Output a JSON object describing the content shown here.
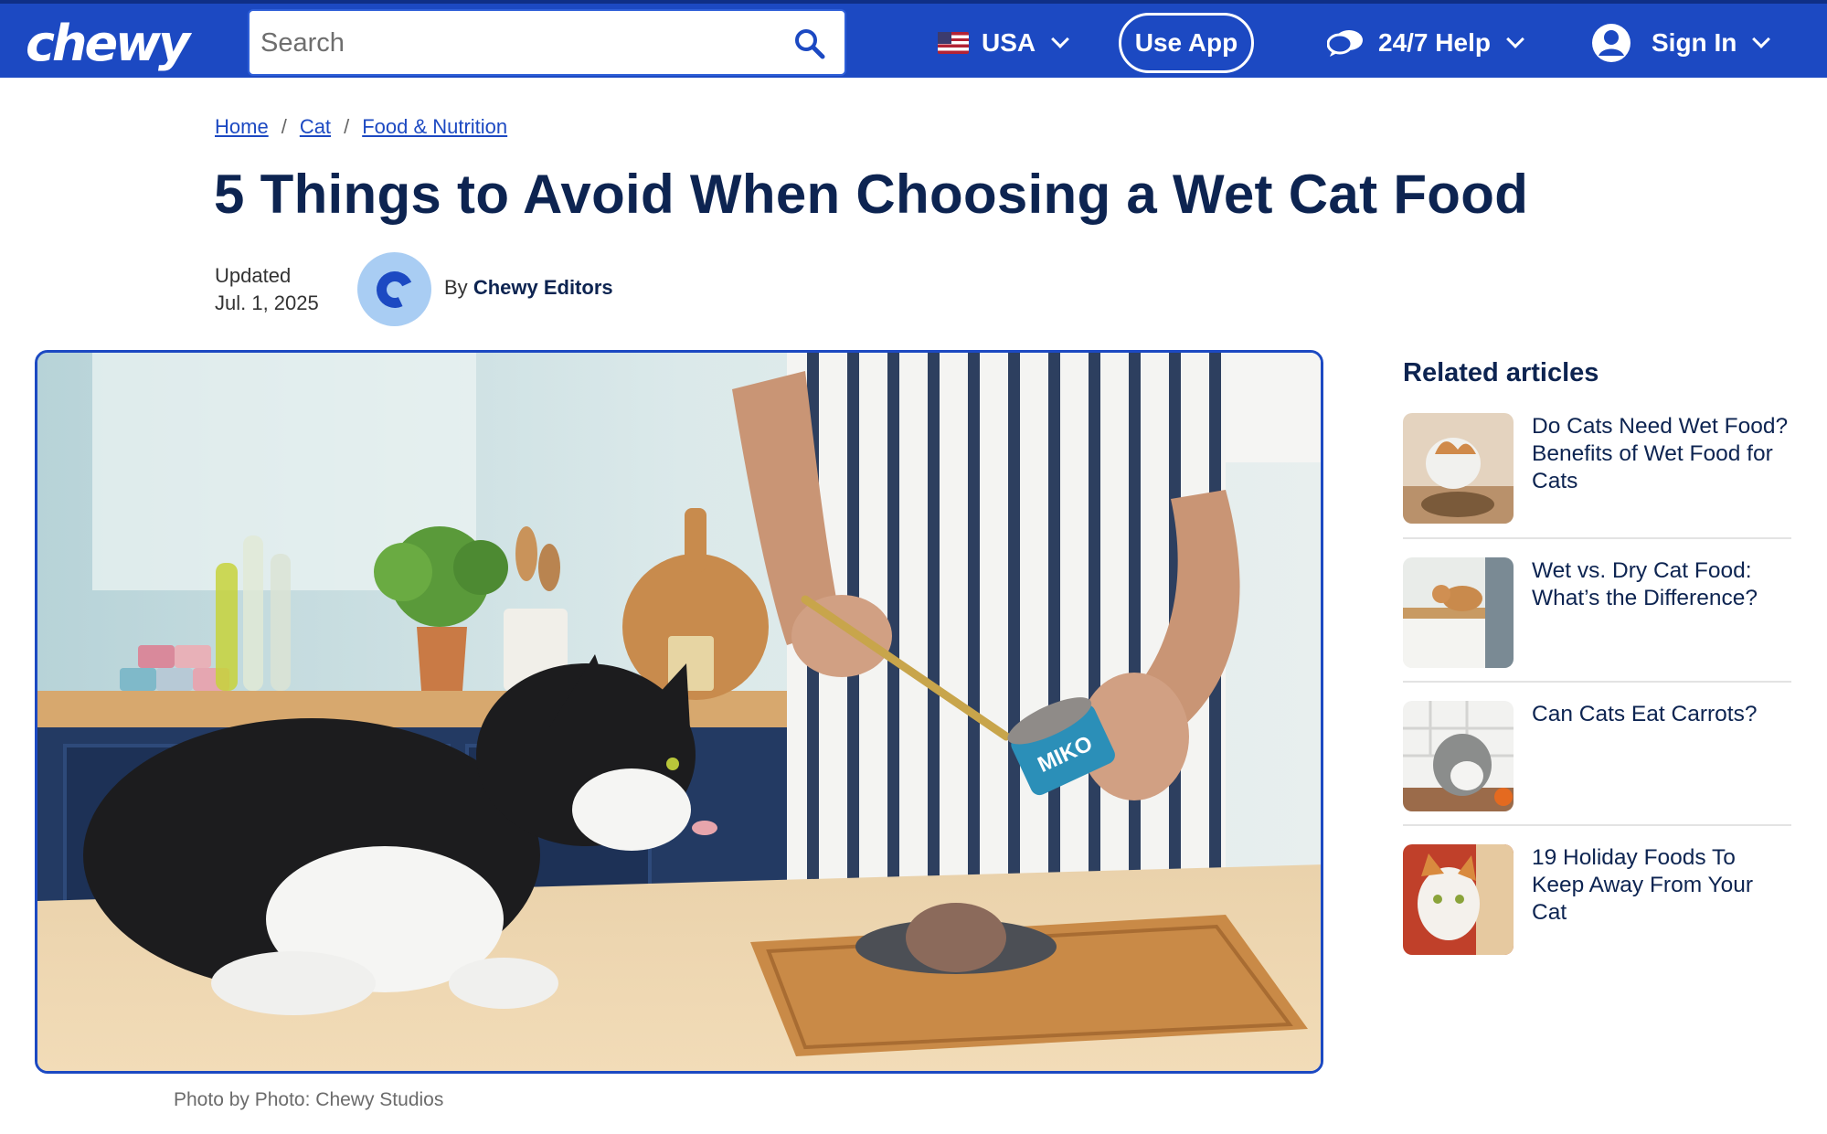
{
  "header": {
    "logo_text": "chewy",
    "search_placeholder": "Search",
    "country": "USA",
    "use_app": "Use App",
    "help": "24/7 Help",
    "sign_in": "Sign In",
    "brand_color": "#1c49c2"
  },
  "breadcrumb": {
    "items": [
      "Home",
      "Cat",
      "Food & Nutrition"
    ],
    "separator": "/"
  },
  "article": {
    "title": "5 Things to Avoid When Choosing a Wet Cat Food",
    "updated_label": "Updated",
    "updated_date": "Jul. 1, 2025",
    "by_label": "By",
    "author": "Chewy Editors",
    "hero_caption": "Photo by Photo: Chewy Studios",
    "can_label": "MIKO"
  },
  "related": {
    "heading_bold": "Related",
    "heading_rest": " articles",
    "items": [
      {
        "title": "Do Cats Need Wet Food? Benefits of Wet Food for Cats"
      },
      {
        "title": "Wet vs. Dry Cat Food: What’s the Difference?"
      },
      {
        "title": "Can Cats Eat Carrots?"
      },
      {
        "title": "19 Holiday Foods To Keep Away From Your Cat"
      }
    ]
  }
}
